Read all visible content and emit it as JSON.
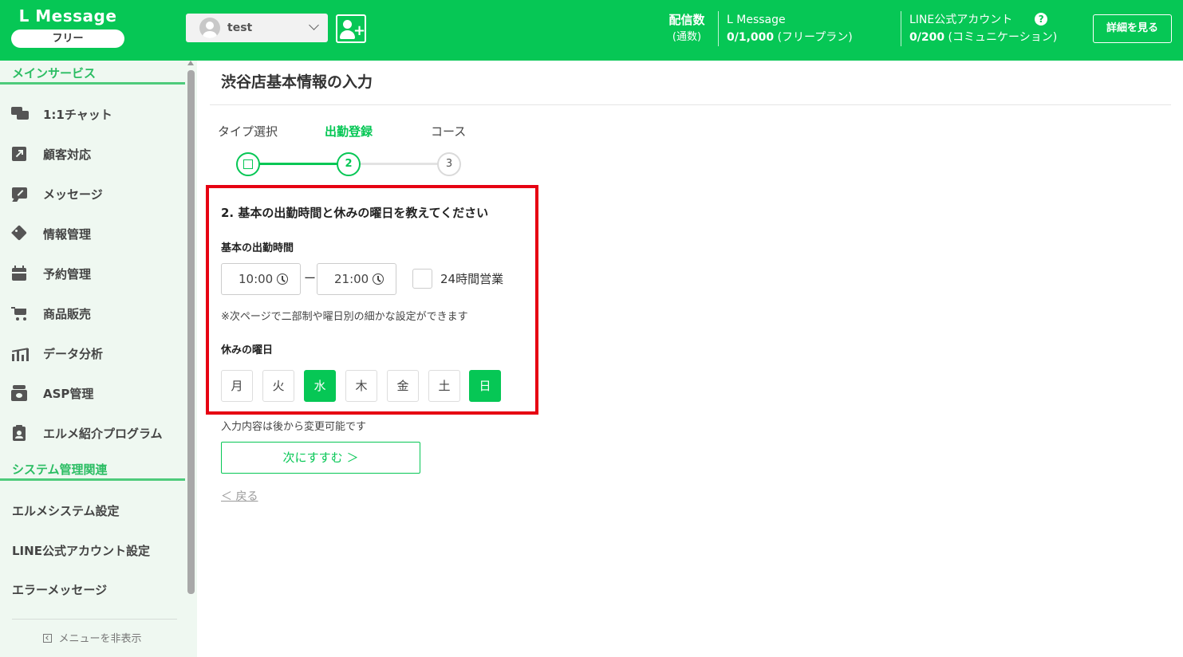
{
  "header": {
    "logo_title": "L Message",
    "plan_badge": "フリー",
    "account_name": "test",
    "delivery_label": "配信数",
    "delivery_sub": "(通数)",
    "lmessage_name": "L Message",
    "lmessage_count": "0/1,000",
    "lmessage_plan": "(フリープラン)",
    "line_name": "LINE公式アカウント",
    "line_count": "0/200",
    "line_plan": "(コミュニケーション)",
    "detail_button": "詳細を見る"
  },
  "sidebar": {
    "section_main": "メインサービス",
    "items": [
      {
        "label": "1:1チャット",
        "icon": "chat-icon"
      },
      {
        "label": "顧客対応",
        "icon": "arrow-up-right-icon"
      },
      {
        "label": "メッセージ",
        "icon": "message-edit-icon"
      },
      {
        "label": "情報管理",
        "icon": "tag-icon"
      },
      {
        "label": "予約管理",
        "icon": "calendar-icon"
      },
      {
        "label": "商品販売",
        "icon": "cart-icon"
      },
      {
        "label": "データ分析",
        "icon": "chart-icon"
      },
      {
        "label": "ASP管理",
        "icon": "register-icon"
      },
      {
        "label": "エルメ紹介プログラム",
        "icon": "clipboard-icon"
      }
    ],
    "section_system": "システム管理関連",
    "system_items": [
      {
        "label": "エルメシステム設定"
      },
      {
        "label": "LINE公式アカウント設定"
      },
      {
        "label": "エラーメッセージ"
      }
    ],
    "hide_menu": "メニューを非表示"
  },
  "main": {
    "page_title": "渋谷店基本情報の入力",
    "steps": [
      {
        "label": "タイプ選択",
        "marker": "",
        "state": "done"
      },
      {
        "label": "出勤登録",
        "marker": "2",
        "state": "active"
      },
      {
        "label": "コース",
        "marker": "3",
        "state": "todo"
      }
    ],
    "question": "2. 基本の出勤時間と休みの曜日を教えてください",
    "work_time_label": "基本の出勤時間",
    "start_time": "10:00",
    "dash": "ー",
    "end_time": "21:00",
    "all_day_label": "24時間営業",
    "all_day_checked": false,
    "note": "※次ページで二部制や曜日別の細かな設定ができます",
    "holiday_label": "休みの曜日",
    "days": [
      {
        "label": "月",
        "selected": false
      },
      {
        "label": "火",
        "selected": false
      },
      {
        "label": "水",
        "selected": true
      },
      {
        "label": "木",
        "selected": false
      },
      {
        "label": "金",
        "selected": false
      },
      {
        "label": "土",
        "selected": false
      },
      {
        "label": "日",
        "selected": true
      }
    ],
    "footer_note": "入力内容は後から変更可能です",
    "next_button": "次にすすむ ＞",
    "back_link": "＜ 戻る"
  },
  "colors": {
    "brand_green": "#06c755",
    "highlight_red": "#e60012",
    "sidebar_bg": "#eff8f1"
  }
}
